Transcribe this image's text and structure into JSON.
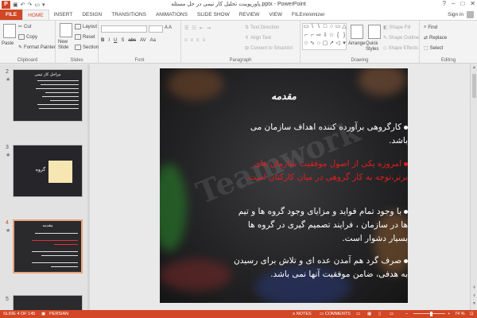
{
  "window": {
    "title": "پاورپوینت تحلیل کار تیمی در حل مسئله.pptx - PowerPoint",
    "app_logo": "P",
    "controls": [
      "?",
      "–",
      "□",
      "✕"
    ]
  },
  "tabs": [
    "FILE",
    "HOME",
    "INSERT",
    "DESIGN",
    "TRANSITIONS",
    "ANIMATIONS",
    "SLIDE SHOW",
    "REVIEW",
    "VIEW",
    "FILEminimizer"
  ],
  "active_tab": "HOME",
  "account": {
    "label": "Sign in"
  },
  "ribbon": {
    "clipboard": {
      "paste": "Paste",
      "cut": "Cut",
      "copy": "Copy",
      "format_painter": "Format Painter",
      "label": "Clipboard"
    },
    "slides": {
      "new_slide": "New Slide",
      "layout": "Layout",
      "reset": "Reset",
      "section": "Section",
      "label": "Slides"
    },
    "font": {
      "label": "Font",
      "style_buttons": [
        "B",
        "I",
        "U",
        "S",
        "abc",
        "AV",
        "Aa"
      ]
    },
    "paragraph": {
      "text_direction": "Text Direction",
      "align_text": "Align Text",
      "convert_smartart": "Convert to SmartArt",
      "label": "Paragraph"
    },
    "drawing": {
      "arrange": "Arrange",
      "quick_styles": "Quick Styles",
      "shape_fill": "Shape Fill",
      "shape_outline": "Shape Outline",
      "shape_effects": "Shape Effects",
      "label": "Drawing"
    },
    "editing": {
      "find": "Find",
      "replace": "Replace",
      "select": "Select",
      "label": "Editing"
    }
  },
  "thumbnails": [
    {
      "number": "2",
      "title": "مراحل کار تیمی"
    },
    {
      "number": "3",
      "title": "گروه"
    },
    {
      "number": "4",
      "title": "مقدمه"
    },
    {
      "number": "5",
      "title": ""
    }
  ],
  "slide": {
    "title": "مقدمه",
    "bullets": [
      {
        "text": "کارگروهی برآورده کننده اهداف سازمان می باشد.",
        "color": "#ffffff"
      },
      {
        "text": "امروزه یکی از اصول موفقیت سازمان های برتر،توجه به کار گروهی در میان کارکنان است.",
        "color": "#e41d1d"
      },
      {
        "text": "با وجود تمام فواید و مزایای وجود گروه ها و تیم ها در سازمان ، فرایند تصمیم گیری در گروه ها بسیار دشوار است.",
        "color": "#ffffff"
      },
      {
        "text": "صرف گرد هم آمدن عده ای و تلاش برای رسیدن به هدفی، ضامن موفقیت آنها نمی باشد.",
        "color": "#ffffff"
      }
    ],
    "watermark": "Teamwork"
  },
  "status": {
    "slide_counter": "SLIDE 4 OF 145",
    "language": "PERSIAN",
    "notes": "NOTES",
    "comments": "COMMENTS",
    "zoom": "74 %",
    "zoom_fraction": 0.74
  },
  "colors": {
    "accent": "#d24726",
    "red_text": "#e41d1d"
  }
}
